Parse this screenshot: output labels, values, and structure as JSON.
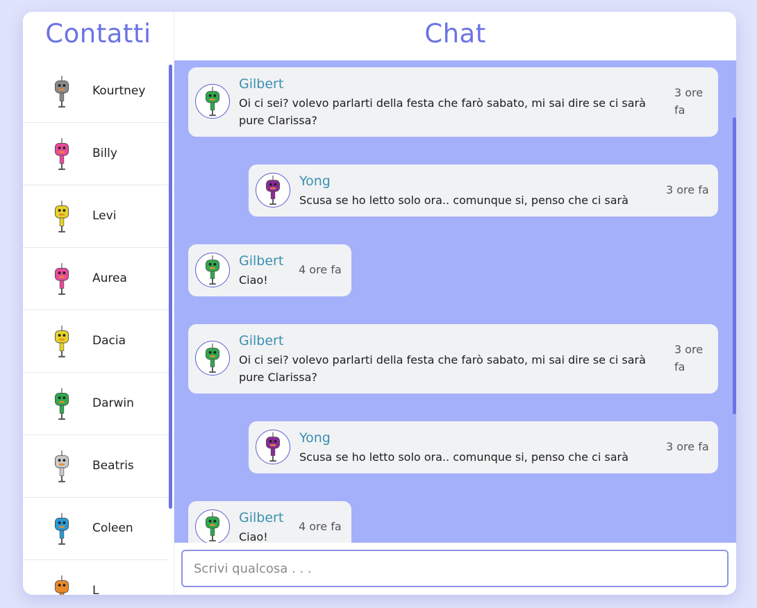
{
  "sidebar": {
    "title": "Contatti",
    "contacts": [
      {
        "name": "Kourtney",
        "color": "#8a8a8a"
      },
      {
        "name": "Billy",
        "color": "#e84a9b"
      },
      {
        "name": "Levi",
        "color": "#e6d12b"
      },
      {
        "name": "Aurea",
        "color": "#e84a9b"
      },
      {
        "name": "Dacia",
        "color": "#e6d12b"
      },
      {
        "name": "Darwin",
        "color": "#2fa84f"
      },
      {
        "name": "Beatris",
        "color": "#c9c9c9"
      },
      {
        "name": "Coleen",
        "color": "#2a9ad8"
      },
      {
        "name": "L",
        "color": "#e8892b"
      }
    ]
  },
  "chat": {
    "title": "Chat",
    "messages": [
      {
        "sender": "Gilbert",
        "text": "Oi ci sei? volevo parlarti della festa che farò sabato, mi sai dire se ci sarà pure Clarissa?",
        "time": "3 ore fa",
        "color": "#2fa84f"
      },
      {
        "sender": "Yong",
        "text": "Scusa se ho letto solo ora.. comunque si, penso che ci sarà",
        "time": "3 ore fa",
        "color": "#8a2a9a"
      },
      {
        "sender": "Gilbert",
        "text": "Ciao!",
        "time": "4 ore fa",
        "color": "#2fa84f"
      },
      {
        "sender": "Gilbert",
        "text": "Oi ci sei? volevo parlarti della festa che farò sabato, mi sai dire se ci sarà pure Clarissa?",
        "time": "3 ore fa",
        "color": "#2fa84f"
      },
      {
        "sender": "Yong",
        "text": "Scusa se ho letto solo ora.. comunque si, penso che ci sarà",
        "time": "3 ore fa",
        "color": "#8a2a9a"
      },
      {
        "sender": "Gilbert",
        "text": "Ciao!",
        "time": "4 ore fa",
        "color": "#2fa84f"
      }
    ]
  },
  "input": {
    "placeholder": "Scrivi qualcosa . . ."
  },
  "colors": {
    "accent": "#6b73e4",
    "chat_bg": "#a5b0fb",
    "sender": "#3a8fb0"
  }
}
